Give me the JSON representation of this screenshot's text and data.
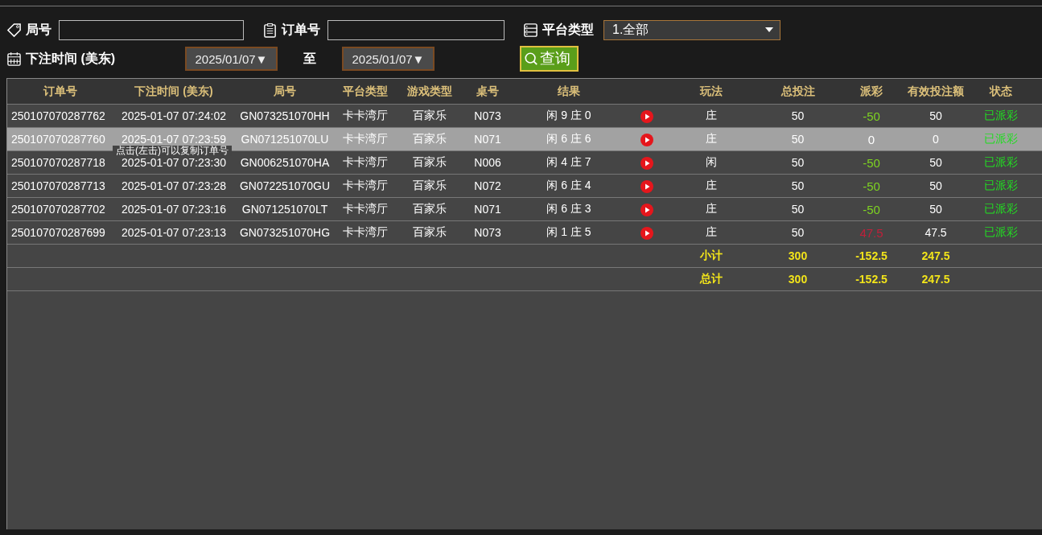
{
  "filters": {
    "round_label": "局号",
    "order_label": "订单号",
    "platform_label": "平台类型",
    "platform_value": "1.全部",
    "time_label": "下注时间 (美东)",
    "date_from": "2025/01/07▼",
    "to_label": "至",
    "date_to": "2025/01/07▼",
    "query_button": "查询"
  },
  "table": {
    "columns": [
      "订单号",
      "下注时间 (美东)",
      "局号",
      "平台类型",
      "游戏类型",
      "桌号",
      "结果",
      "",
      "玩法",
      "总投注",
      "派彩",
      "有效投注额",
      "状态"
    ],
    "rows": [
      {
        "order": "250107070287762",
        "time": "2025-01-07 07:24:02",
        "round": "GN073251070HH",
        "platform": "卡卡湾厅",
        "game": "百家乐",
        "table": "N073",
        "result": "闲 9 庄 0",
        "play": "庄",
        "bet": "50",
        "payout": {
          "text": "-50",
          "color": "#7ed321"
        },
        "valid": "50",
        "status": "已派彩",
        "selected": false
      },
      {
        "order": "250107070287760",
        "time": "2025-01-07 07:23:59",
        "round": "GN071251070LU",
        "platform": "卡卡湾厅",
        "game": "百家乐",
        "table": "N071",
        "result": "闲 6 庄 6",
        "play": "庄",
        "bet": "50",
        "payout": {
          "text": "0",
          "color": "#ffffff"
        },
        "valid": "0",
        "status": "已派彩",
        "selected": true
      },
      {
        "order": "250107070287718",
        "time": "2025-01-07 07:23:30",
        "round": "GN006251070HA",
        "platform": "卡卡湾厅",
        "game": "百家乐",
        "table": "N006",
        "result": "闲 4 庄 7",
        "play": "闲",
        "bet": "50",
        "payout": {
          "text": "-50",
          "color": "#7ed321"
        },
        "valid": "50",
        "status": "已派彩",
        "selected": false
      },
      {
        "order": "250107070287713",
        "time": "2025-01-07 07:23:28",
        "round": "GN072251070GU",
        "platform": "卡卡湾厅",
        "game": "百家乐",
        "table": "N072",
        "result": "闲 6 庄 4",
        "play": "庄",
        "bet": "50",
        "payout": {
          "text": "-50",
          "color": "#7ed321"
        },
        "valid": "50",
        "status": "已派彩",
        "selected": false
      },
      {
        "order": "250107070287702",
        "time": "2025-01-07 07:23:16",
        "round": "GN071251070LT",
        "platform": "卡卡湾厅",
        "game": "百家乐",
        "table": "N071",
        "result": "闲 6 庄 3",
        "play": "庄",
        "bet": "50",
        "payout": {
          "text": "-50",
          "color": "#7ed321"
        },
        "valid": "50",
        "status": "已派彩",
        "selected": false
      },
      {
        "order": "250107070287699",
        "time": "2025-01-07 07:23:13",
        "round": "GN073251070HG",
        "platform": "卡卡湾厅",
        "game": "百家乐",
        "table": "N073",
        "result": "闲 1 庄 5",
        "play": "庄",
        "bet": "50",
        "payout": {
          "text": "47.5",
          "color": "#c0203a"
        },
        "valid": "47.5",
        "status": "已派彩",
        "selected": false
      }
    ],
    "summary": [
      {
        "label": "小计",
        "bet": "300",
        "payout": "-152.5",
        "valid": "247.5"
      },
      {
        "label": "总计",
        "bet": "300",
        "payout": "-152.5",
        "valid": "247.5"
      }
    ]
  },
  "tooltip": "点击(左击)可以复制订单号"
}
